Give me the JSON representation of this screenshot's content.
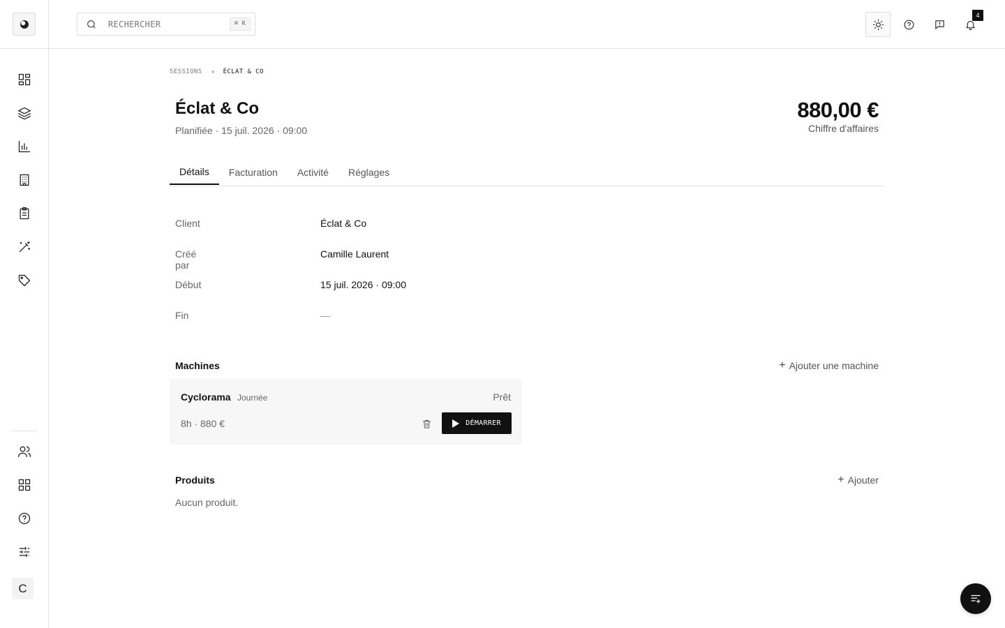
{
  "search": {
    "placeholder": "RECHERCHER",
    "shortcut": "⌘ K"
  },
  "sidebar": {
    "items": [
      {
        "icon": "dashboard-icon"
      },
      {
        "icon": "layers-icon"
      },
      {
        "icon": "bar-chart-icon"
      },
      {
        "icon": "building-icon"
      },
      {
        "icon": "clipboard-icon"
      },
      {
        "icon": "magic-wand-icon"
      },
      {
        "icon": "tag-icon"
      }
    ],
    "bottom_items": [
      {
        "icon": "users-icon"
      },
      {
        "icon": "apps-grid-icon"
      },
      {
        "icon": "help-circle-icon"
      },
      {
        "icon": "sliders-icon"
      }
    ],
    "user_initial": "C"
  },
  "topbar": {
    "icons": [
      "sun-icon",
      "help-circle-icon",
      "feedback-icon",
      "bell-icon"
    ],
    "notification_count": "4"
  },
  "breadcrumb": {
    "parent": "SESSIONS",
    "current": "ÉCLAT & CO"
  },
  "header": {
    "title": "Éclat & Co",
    "subtitle": "Planifiée · 15 juil. 2026 · 09:00",
    "amount": "880,00 €",
    "amount_label": "Chiffre d'affaires"
  },
  "tabs": [
    {
      "label": "Détails",
      "active": true
    },
    {
      "label": "Facturation",
      "active": false
    },
    {
      "label": "Activité",
      "active": false
    },
    {
      "label": "Réglages",
      "active": false
    }
  ],
  "details": [
    {
      "label": "Client",
      "value": "Éclat & Co"
    },
    {
      "label": "Créé par",
      "value": "Camille Laurent"
    },
    {
      "label": "Début",
      "value": "15 juil. 2026 · 09:00"
    },
    {
      "label": "Fin",
      "value": "—"
    }
  ],
  "machines": {
    "title": "Machines",
    "add_label": "Ajouter une machine",
    "items": [
      {
        "name": "Cyclorama",
        "tag": "Journée",
        "status": "Prêt",
        "meta": "8h · 880 €",
        "start_label": "DÉMARRER"
      }
    ]
  },
  "products": {
    "title": "Produits",
    "add_label": "Ajouter",
    "empty": "Aucun produit."
  },
  "colors": {
    "accent": "#111111",
    "muted_text": "#666666",
    "card_bg": "#f7f7f7"
  }
}
